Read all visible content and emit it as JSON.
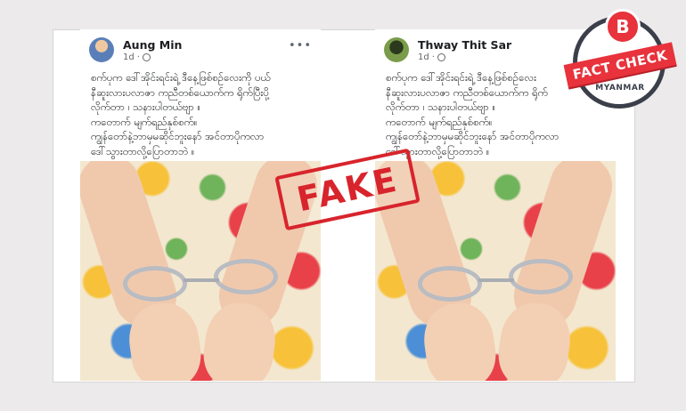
{
  "posts": [
    {
      "author": "Aung Min",
      "time": "1d",
      "more": "•••",
      "text": "စက်ပုက ဒေါ်အိုင်းရင်းရဲ့ ဒီနေ့ဖြစ်စဥ်လေးကို ပယ်\nနီဆူးလားပလာဇာ ကညီတစ်ယောက်က ရိုက်ပြီးပို့\nလိုက်တာ ၊ သနားပါတယ်ဗျာ ။\nကတောက် မျက်ရည်နှစ်စက်။\nကျွန်တော်နဲ့ဘာမှမဆိုင်ဘူးနော် အင်တာပိုကလာ\nဒေါ်သွားတာလို့ပြောတာဘဲ ။"
    },
    {
      "author": "Thway Thit Sar",
      "time": "1d",
      "more": "",
      "text": "စက်ပုက ဒေါ်အိုင်းရင်းရဲ့ ဒီနေ့ဖြစ်စဥ်လေး\nနီဆူးလားပလာဇာ ကညီတစ်ယောက်က ရိုက်\nလိုက်တာ ၊ သနားပါတယ်ဗျာ ။\nကတောက် မျက်ရည်နှစ်စက်။\nကျွန်တော်နဲ့ဘာမှမဆိုင်ဘူးနော် အင်တာပိုကလာ\nဒေါ်သွားတာလို့ပြောတာဘဲ ။"
    }
  ],
  "stamp": "FAKE",
  "badge": {
    "letter": "B",
    "ribbon": "FACT CHECK",
    "sub": "MYANMAR"
  },
  "colors": {
    "stamp": "#d8242c",
    "badge_red": "#e8323c",
    "badge_ring": "#3a3f4a"
  }
}
